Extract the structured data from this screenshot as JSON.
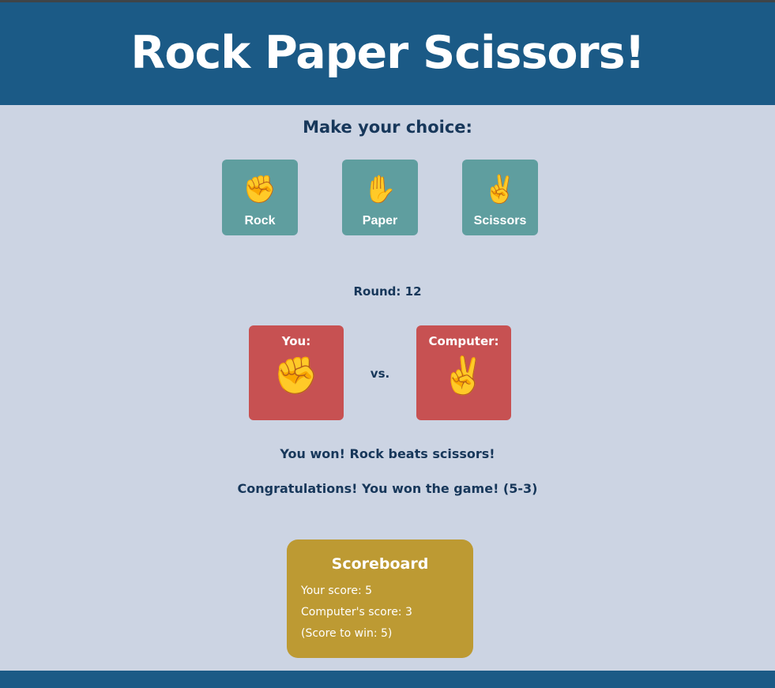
{
  "title": "Rock Paper Scissors!",
  "prompt": "Make your choice:",
  "choices": [
    {
      "label": "Rock",
      "emoji": "✊"
    },
    {
      "label": "Paper",
      "emoji": "✋"
    },
    {
      "label": "Scissors",
      "emoji": "✌️"
    }
  ],
  "round": "Round: 12",
  "player_card": {
    "label": "You:",
    "emoji": "✊"
  },
  "vs": "vs.",
  "computer_card": {
    "label": "Computer:",
    "emoji": "✌️"
  },
  "round_result": "You won! Rock beats scissors!",
  "game_result": "Congratulations! You won the game! (5-3)",
  "scoreboard": {
    "title": "Scoreboard",
    "your_score": "Your score: 5",
    "computer_score": "Computer's score: 3",
    "score_to_win": "(Score to win: 5)"
  },
  "colors": {
    "header": "#1b5a86",
    "background": "#ccd4e3",
    "choice_button": "#5f9e9f",
    "card": "#c75152",
    "scoreboard": "#bd9a33",
    "text": "#17375a"
  }
}
